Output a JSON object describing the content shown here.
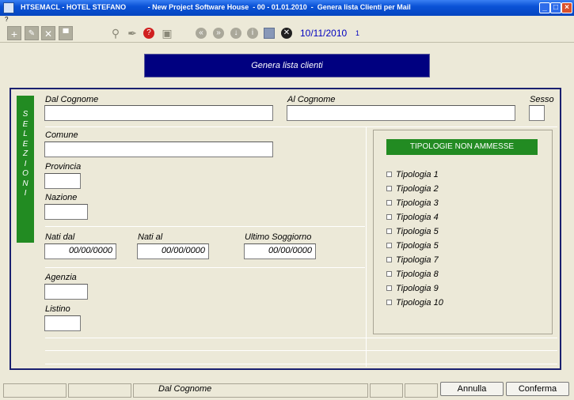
{
  "window": {
    "title": "HTSEMACL - HOTEL STEFANO           - New Project Software House  - 00 - 01.01.2010  -  Genera lista Clienti per Mail"
  },
  "menu": {
    "help": "?"
  },
  "toolbar": {
    "date": "10/11/2010",
    "count": "1"
  },
  "banner": "Genera lista clienti",
  "side_tab": "SELEZIONI",
  "form": {
    "dal_cognome": {
      "label": "Dal Cognome",
      "value": ""
    },
    "al_cognome": {
      "label": "Al Cognome",
      "value": ""
    },
    "sesso": {
      "label": "Sesso",
      "value": ""
    },
    "comune": {
      "label": "Comune",
      "value": ""
    },
    "provincia": {
      "label": "Provincia",
      "value": ""
    },
    "nazione": {
      "label": "Nazione",
      "value": ""
    },
    "nati_dal": {
      "label": "Nati dal",
      "value": "00/00/0000"
    },
    "nati_al": {
      "label": "Nati al",
      "value": "00/00/0000"
    },
    "ultimo_soggiorno": {
      "label": "Ultimo Soggiorno",
      "value": "00/00/0000"
    },
    "agenzia": {
      "label": "Agenzia",
      "value": ""
    },
    "listino": {
      "label": "Listino",
      "value": ""
    }
  },
  "tipologie": {
    "header": "TIPOLOGIE NON AMMESSE",
    "items": [
      "Tipologia  1",
      "Tipologia  2",
      "Tipologia  3",
      "Tipologia  4",
      "Tipologia  5",
      "Tipologia  5",
      "Tipologia  7",
      "Tipologia  8",
      "Tipologia  9",
      "Tipologia 10"
    ]
  },
  "status": {
    "field": "Dal Cognome"
  },
  "buttons": {
    "annulla": "Annulla",
    "conferma": "Conferma"
  }
}
